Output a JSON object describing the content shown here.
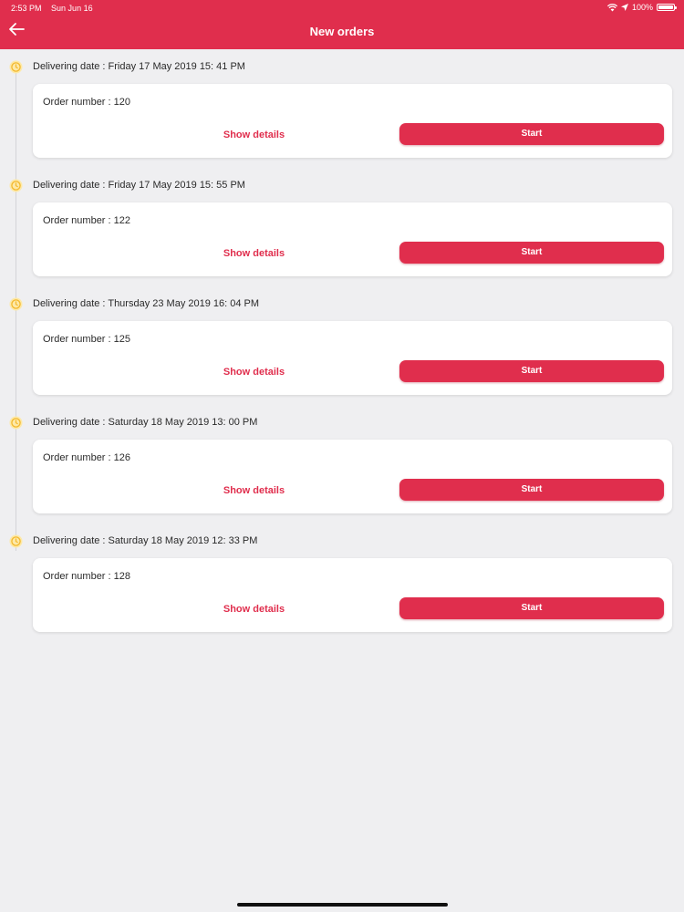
{
  "status_bar": {
    "time": "2:53 PM",
    "date": "Sun Jun 16",
    "battery": "100%"
  },
  "header": {
    "title": "New orders",
    "back_icon": "arrow-left-icon"
  },
  "colors": {
    "accent": "#e02e4d",
    "background": "#efeff1",
    "clock": "#f6c343"
  },
  "orders": [
    {
      "date_label": "Delivering date : Friday 17 May 2019 15: 41 PM",
      "order_label": "Order number : 120",
      "details_label": "Show details",
      "start_label": "Start"
    },
    {
      "date_label": "Delivering date : Friday 17 May 2019 15: 55 PM",
      "order_label": "Order number : 122",
      "details_label": "Show details",
      "start_label": "Start"
    },
    {
      "date_label": "Delivering date : Thursday 23 May 2019 16: 04 PM",
      "order_label": "Order number : 125",
      "details_label": "Show details",
      "start_label": "Start"
    },
    {
      "date_label": "Delivering date : Saturday 18 May 2019 13: 00 PM",
      "order_label": "Order number : 126",
      "details_label": "Show details",
      "start_label": "Start"
    },
    {
      "date_label": "Delivering date : Saturday 18 May 2019 12: 33 PM",
      "order_label": "Order number : 128",
      "details_label": "Show details",
      "start_label": "Start"
    }
  ]
}
